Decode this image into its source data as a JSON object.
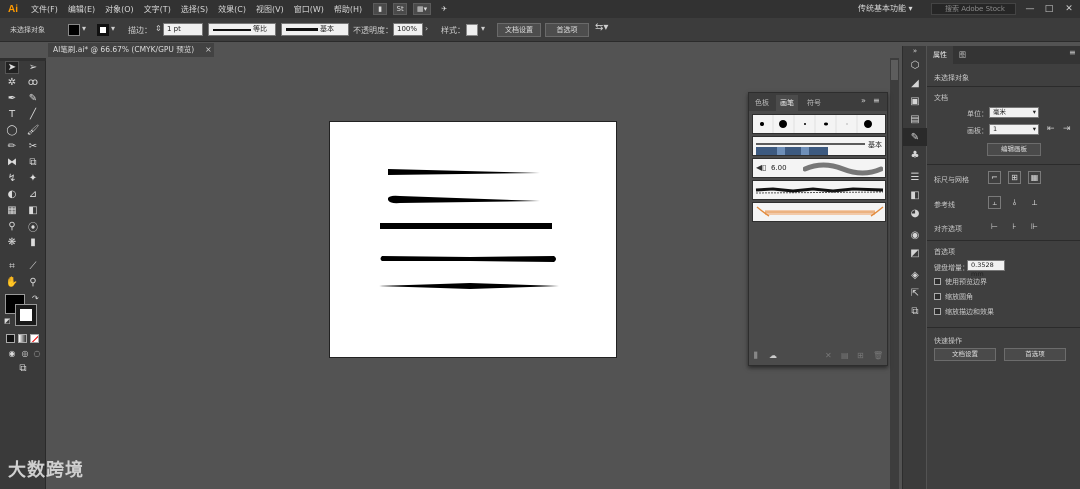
{
  "app": {
    "logo": "Ai"
  },
  "menu": [
    "文件(F)",
    "编辑(E)",
    "对象(O)",
    "文字(T)",
    "选择(S)",
    "效果(C)",
    "视图(V)",
    "窗口(W)",
    "帮助(H)"
  ],
  "menu_mini": {
    "st": "St"
  },
  "workspace": {
    "label": "传统基本功能"
  },
  "stock_search": {
    "placeholder": "搜索 Adobe Stock"
  },
  "control": {
    "no_selection": "未选择对象",
    "stroke_label": "描边：",
    "stroke_weight": "1 pt",
    "profile_label": "等比",
    "brush_label": "基本",
    "opacity_label": "不透明度：",
    "opacity_value": "100%",
    "style_label": "样式：",
    "doc_setup": "文档设置",
    "preferences": "首选项"
  },
  "doc_tab": {
    "title": "AI笔刷.ai* @ 66.67% (CMYK/GPU 预览)",
    "close": "×"
  },
  "brush_panel": {
    "tabs": [
      "色板",
      "画笔",
      "符号"
    ],
    "active_tab": 1,
    "basic_label": "基本",
    "calligraphic_size": "6.00"
  },
  "properties": {
    "tabs": [
      "属性",
      "图"
    ],
    "no_selection": "未选择对象",
    "document_section": "文档",
    "units_label": "单位：",
    "units_value": "毫米",
    "artboard_label": "画板：",
    "artboard_value": "1",
    "edit_artboards": "编辑画板",
    "rulers_grids": "标尺与网格",
    "guides": "参考线",
    "snap": "对齐选项",
    "preferences_section": "首选项",
    "keyboard_increment_label": "键盘增量：",
    "keyboard_increment_value": "0.3528 mm",
    "check_preview_bounds": "使用预览边界",
    "check_scale_corners": "缩放圆角",
    "check_scale_strokes": "缩放描边和效果",
    "quick_actions": "快速操作",
    "doc_setup_btn": "文档设置",
    "preferences_btn": "首选项"
  },
  "colors": {
    "accent": "#ff9a00",
    "ui_dark": "#323232",
    "canvas": "#535353",
    "artboard": "#ffffff"
  },
  "watermark": {
    "text": "大数跨境"
  }
}
